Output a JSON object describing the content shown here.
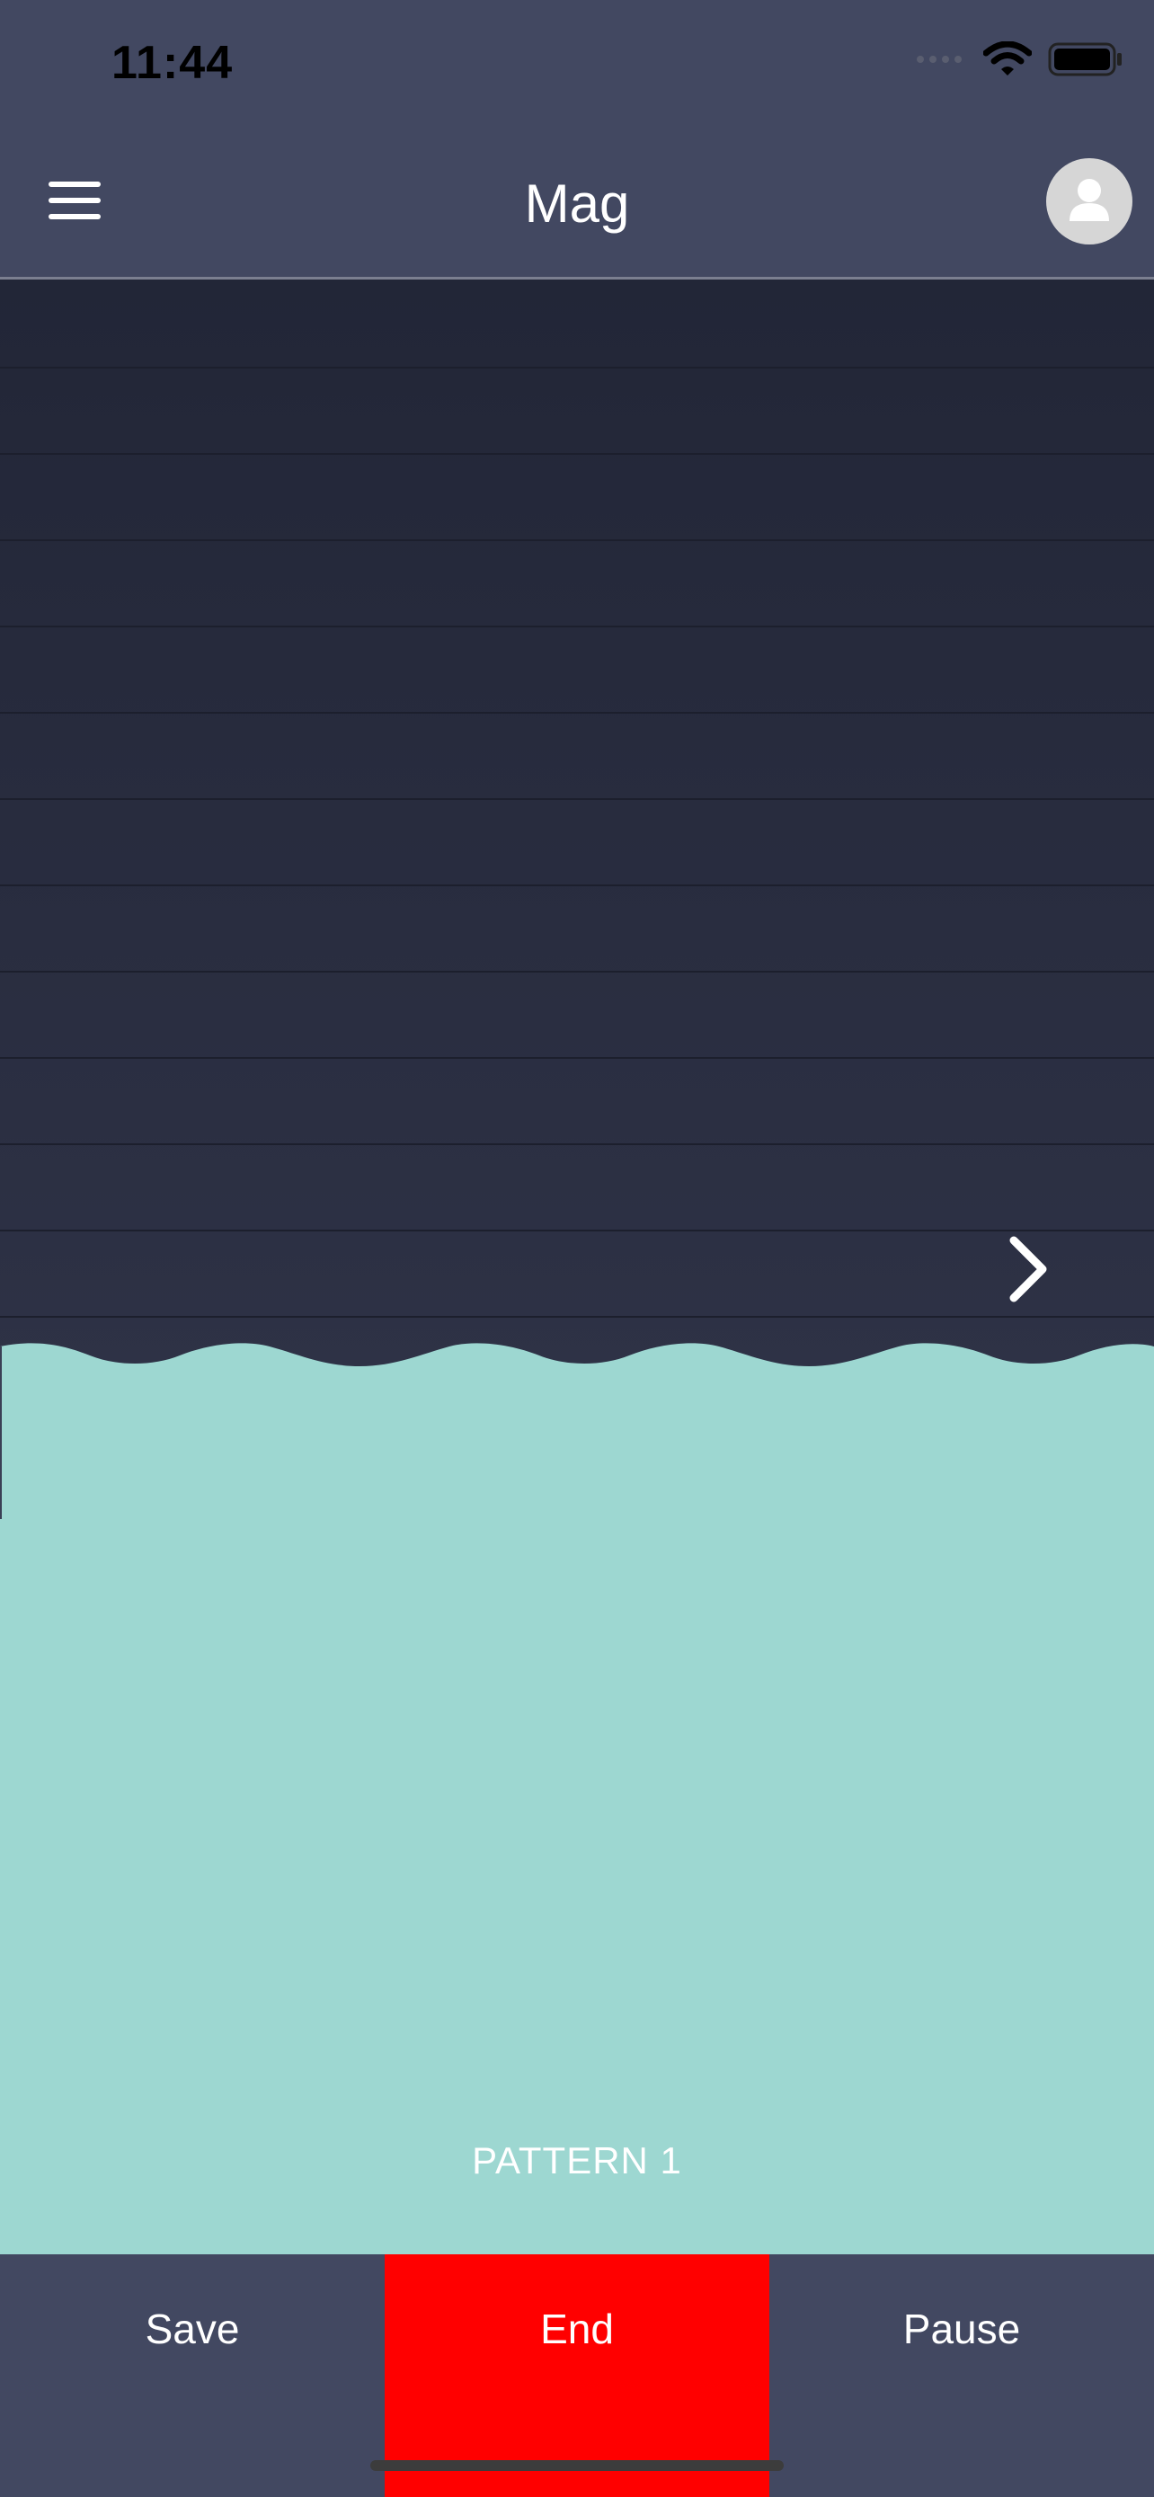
{
  "status_bar": {
    "time": "11:44"
  },
  "header": {
    "title": "Mag"
  },
  "main": {
    "pattern_label": "PATTERN 1"
  },
  "footer": {
    "save_label": "Save",
    "end_label": "End",
    "pause_label": "Pause"
  },
  "colors": {
    "header_bg": "#424861",
    "content_bg": "#2b2f43",
    "water": "#9dd7d1",
    "end_button": "#ff0000"
  },
  "icons": [
    "menu-icon",
    "avatar-icon",
    "chevron-right-icon",
    "wifi-icon",
    "battery-icon",
    "cellular-icon"
  ]
}
